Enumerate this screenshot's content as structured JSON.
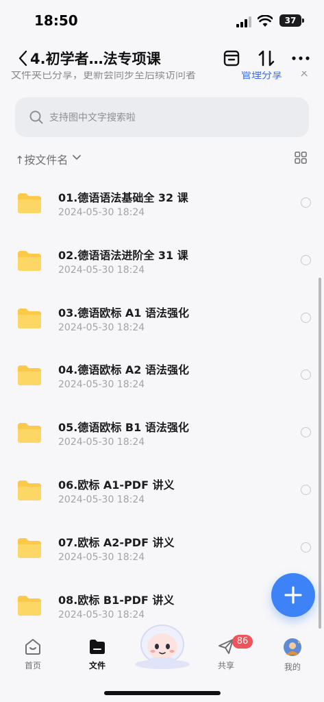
{
  "status_bar": {
    "time": "18:50",
    "battery": "37"
  },
  "nav": {
    "title": "4.初学者…法专项课",
    "back_icon": "chevron-left-icon",
    "actions": [
      "archive-icon",
      "sort-arrows-icon",
      "more-icon"
    ]
  },
  "share_banner": {
    "text": "文件夹已分享，更新会同步至后续访问者",
    "manage_label": "管理分享",
    "close_label": "×"
  },
  "search": {
    "placeholder": "支持图中文字搜索啦"
  },
  "sort": {
    "label": "↑按文件名"
  },
  "files": [
    {
      "name": "01.德语语法基础全 32 课",
      "date": "2024-05-30 18:24"
    },
    {
      "name": "02.德语语法进阶全 31 课",
      "date": "2024-05-30 18:24"
    },
    {
      "name": "03.德语欧标 A1 语法强化",
      "date": "2024-05-30 18:24"
    },
    {
      "name": "04.德语欧标 A2 语法强化",
      "date": "2024-05-30 18:24"
    },
    {
      "name": "05.德语欧标 B1 语法强化",
      "date": "2024-05-30 18:24"
    },
    {
      "name": "06.欧标 A1-PDF 讲义",
      "date": "2024-05-30 18:24"
    },
    {
      "name": "07.欧标 A2-PDF 讲义",
      "date": "2024-05-30 18:24"
    },
    {
      "name": "08.欧标 B1-PDF 讲义",
      "date": "2024-05-30 18:24"
    }
  ],
  "tabs": [
    {
      "label": "首页",
      "icon": "home-icon"
    },
    {
      "label": "文件",
      "icon": "folder-icon"
    },
    {
      "label": "共享",
      "icon": "paper-plane-icon"
    },
    {
      "label": "我的",
      "icon": "avatar"
    }
  ],
  "share_badge": "86",
  "colors": {
    "accent": "#3d83f7",
    "folder": "#fcc94a",
    "badge": "#f0535a",
    "link": "#3d6ef5"
  }
}
